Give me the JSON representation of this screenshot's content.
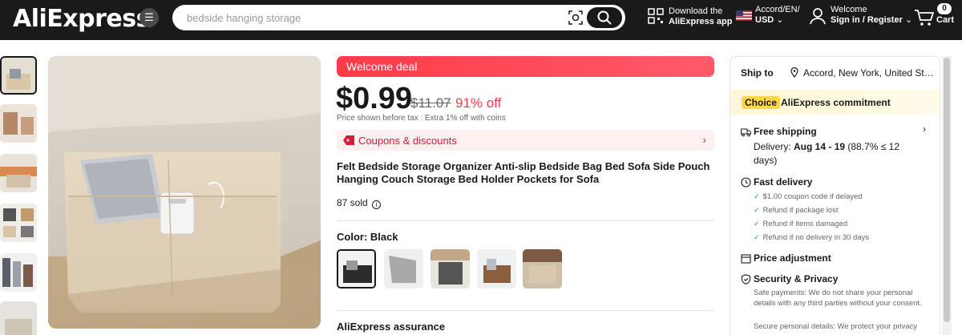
{
  "header": {
    "logo": "AliExpress",
    "search": {
      "placeholder": "bedside hanging storage"
    },
    "app_line1": "Download the",
    "app_line2": "AliExpress app",
    "lang_line1": "Accord/EN/",
    "lang_line2": "USD",
    "welcome_line1": "Welcome",
    "welcome_line2": "Sign in / Register",
    "cart_count": "0",
    "cart_label": "Cart"
  },
  "gallery": {
    "thumb_count": 6,
    "selected_index": 0
  },
  "product": {
    "deal_label": "Welcome deal",
    "price": "$0.99",
    "original_price": "$11.07",
    "discount": "91% off",
    "tax_note": "Price shown before tax",
    "coins_note": "Extra 1% off with coins",
    "coupon_label": "Coupons & discounts",
    "title": "Felt Bedside Storage Organizer Anti-slip Bedside Bag Bed Sofa Side Pouch Hanging Couch Storage Bed Holder Pockets for Sofa",
    "sold": "87 sold",
    "color_label": "Color: Black",
    "swatch_count": 5,
    "selected_swatch": 0,
    "assurance_label": "AliExpress assurance"
  },
  "shipping_panel": {
    "ship_to_label": "Ship to",
    "location": "Accord, New York, United States",
    "choice_badge": "Choice",
    "commitment": "AliExpress commitment",
    "free_shipping": "Free shipping",
    "delivery_prefix": "Delivery: ",
    "delivery_dates": "Aug 14 - 19",
    "delivery_suffix": " (88.7% ≤ 12 days)",
    "fast_delivery": "Fast delivery",
    "fast_items": [
      "$1.00 coupon code if delayed",
      "Refund if package lost",
      "Refund if items damaged",
      "Refund if no delivery in 30 days"
    ],
    "price_adjustment": "Price adjustment",
    "security": "Security & Privacy",
    "security_text": "Safe payments: We do not share your personal details with any third parties without your consent.",
    "security_text2": "Secure personal details: We protect your privacy"
  },
  "colors": {
    "header_bg": "#1a1a1a",
    "deal_red": "#fd3b48",
    "discount_red": "#fd384f",
    "choice_yellow": "#ffd74a"
  }
}
